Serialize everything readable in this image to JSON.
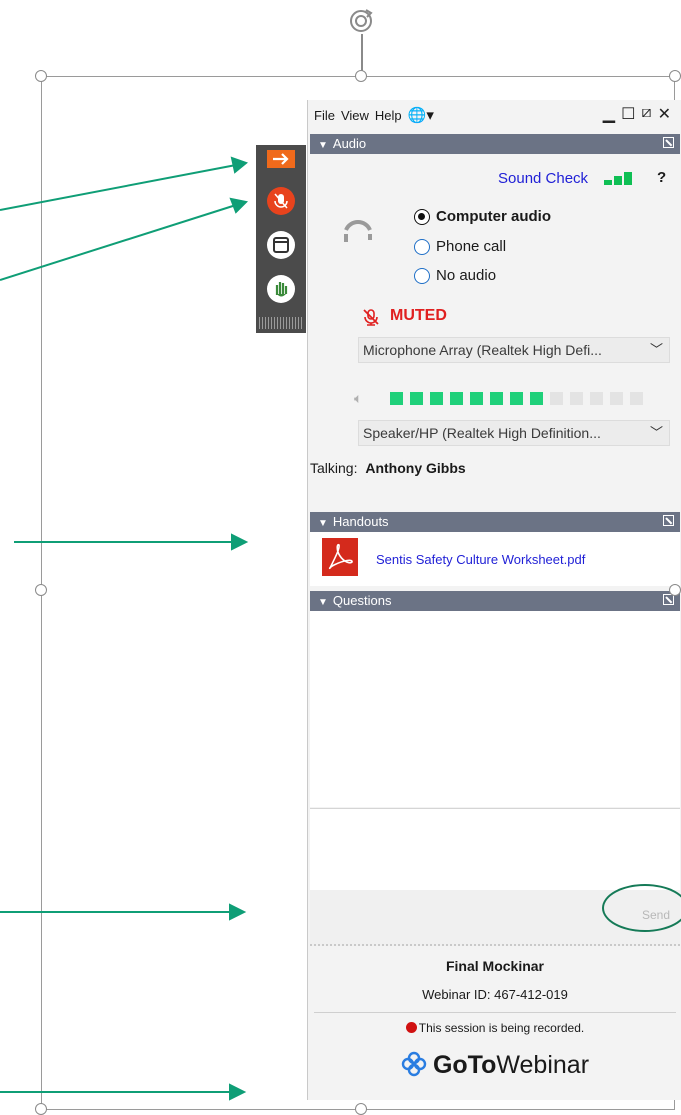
{
  "menu": {
    "file": "File",
    "view": "View",
    "help": "Help"
  },
  "window_controls": [
    "minimize-icon",
    "maximize-icon",
    "popout-icon",
    "close-icon"
  ],
  "audio": {
    "header": "Audio",
    "sound_check": "Sound Check",
    "help": "?",
    "options": [
      "Computer audio",
      "Phone call",
      "No audio"
    ],
    "selected": "Computer audio",
    "muted_label": "MUTED",
    "microphone": "Microphone Array (Realtek High Defi...",
    "speaker": "Speaker/HP (Realtek High Definition...",
    "speaker_level_bars_lit": 8,
    "speaker_level_bars_total": 13,
    "talking_label": "Talking:",
    "talking_name": "Anthony Gibbs"
  },
  "handouts": {
    "header": "Handouts",
    "file": "Sentis Safety Culture Worksheet.pdf"
  },
  "questions": {
    "header": "Questions",
    "send": "Send"
  },
  "footer": {
    "title": "Final Mockinar",
    "webinar_id": "Webinar ID: 467-412-019",
    "recording": "This session is being recorded.",
    "brand_bold": "GoTo",
    "brand_light": "Webinar"
  },
  "colors": {
    "accent_green": "#0f9e76",
    "header_bar": "#6b7385",
    "muted_red": "#e02020",
    "link_blue": "#1f1fd6"
  }
}
